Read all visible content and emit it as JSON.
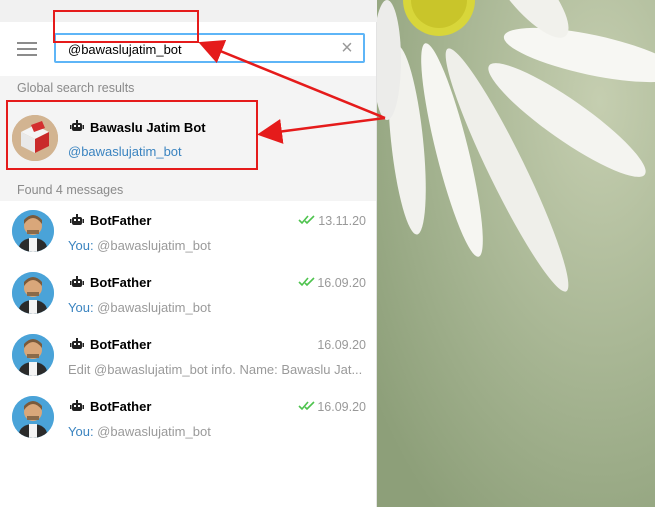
{
  "search": {
    "value": "@bawaslujatim_bot",
    "clear_icon": "×"
  },
  "global_header": "Global search results",
  "global_result": {
    "title": "Bawaslu Jatim Bot",
    "username": "@bawaslujatim_bot"
  },
  "messages_header": "Found 4 messages",
  "messages": [
    {
      "title": "BotFather",
      "date": "13.11.20",
      "read": true,
      "prefix": "You: ",
      "text": "@bawaslujatim_bot"
    },
    {
      "title": "BotFather",
      "date": "16.09.20",
      "read": true,
      "prefix": "You: ",
      "text": "@bawaslujatim_bot"
    },
    {
      "title": "BotFather",
      "date": "16.09.20",
      "read": false,
      "prefix": "",
      "text": "Edit @bawaslujatim_bot info.  Name: Bawaslu Jat..."
    },
    {
      "title": "BotFather",
      "date": "16.09.20",
      "read": true,
      "prefix": "You: ",
      "text": "@bawaslujatim_bot"
    }
  ],
  "colors": {
    "accent": "#5eb5f7",
    "highlight": "#e51b1b",
    "link": "#3b84c0",
    "check": "#4dc34d"
  }
}
